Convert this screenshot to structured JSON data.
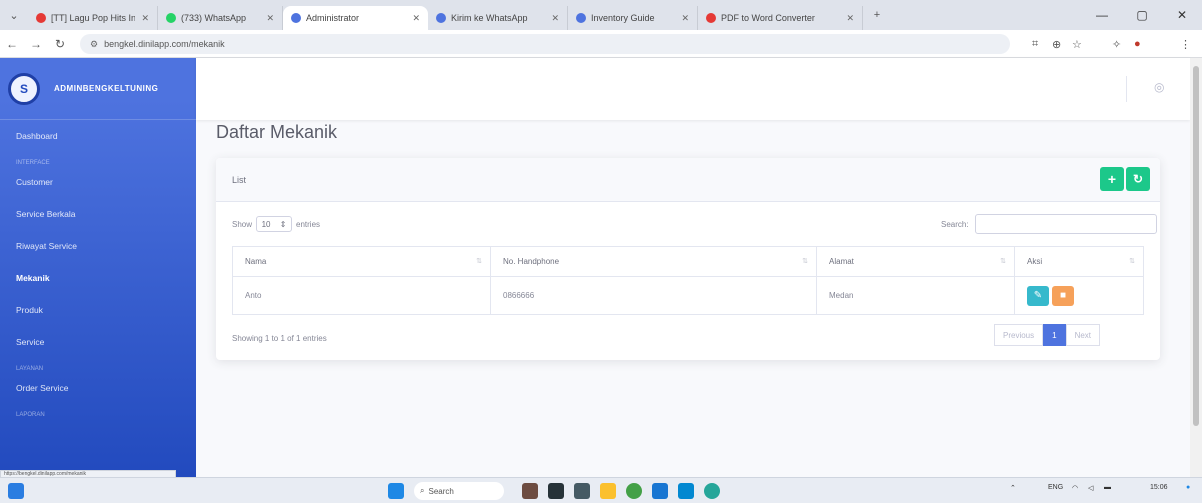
{
  "browser": {
    "tabs": [
      {
        "title": "[TT] Lagu Pop Hits Ind...",
        "color": "#e53935"
      },
      {
        "title": "(733) WhatsApp",
        "color": "#25d366"
      },
      {
        "title": "Administrator",
        "color": "#4e73df",
        "active": true
      },
      {
        "title": "Kirim ke WhatsApp",
        "color": "#4e73df"
      },
      {
        "title": "Inventory Guide",
        "color": "#4e73df"
      },
      {
        "title": "PDF to Word Converter",
        "color": "#e53935"
      }
    ],
    "url": "bengkel.dinilapp.com/mekanik",
    "status_url": "https://bengkel.dinilapp.com/mekanik"
  },
  "sidebar": {
    "brand": "ADMINBENGKELTUNING",
    "logo_text": "S",
    "items": [
      {
        "type": "item",
        "label": "Dashboard"
      },
      {
        "type": "heading",
        "label": "Interface"
      },
      {
        "type": "item",
        "label": "Customer"
      },
      {
        "type": "item",
        "label": "Service Berkala"
      },
      {
        "type": "item",
        "label": "Riwayat Service"
      },
      {
        "type": "item",
        "label": "Mekanik",
        "active": true
      },
      {
        "type": "item",
        "label": "Produk"
      },
      {
        "type": "item",
        "label": "Service"
      },
      {
        "type": "heading",
        "label": "Layanan"
      },
      {
        "type": "item",
        "label": "Order Service"
      },
      {
        "type": "heading",
        "label": "Laporan"
      }
    ]
  },
  "page": {
    "title": "Daftar Mekanik",
    "card_title": "List",
    "show_label": "Show",
    "entries_label": "entries",
    "page_length": "10",
    "search_label": "Search:",
    "columns": [
      "Nama",
      "No. Handphone",
      "Alamat",
      "Aksi"
    ],
    "rows": [
      {
        "nama": "Anto",
        "hp": "0866666",
        "alamat": "Medan"
      }
    ],
    "info": "Showing 1 to 1 of 1 entries",
    "pager": {
      "previous": "Previous",
      "current": "1",
      "next": "Next"
    }
  },
  "taskbar": {
    "search_placeholder": "Search",
    "lang": "ENG",
    "time": "15:06"
  },
  "colors": {
    "primary": "#4e73df",
    "success": "#1cc88a",
    "info": "#36b9cc",
    "warning": "#f6a15a"
  }
}
